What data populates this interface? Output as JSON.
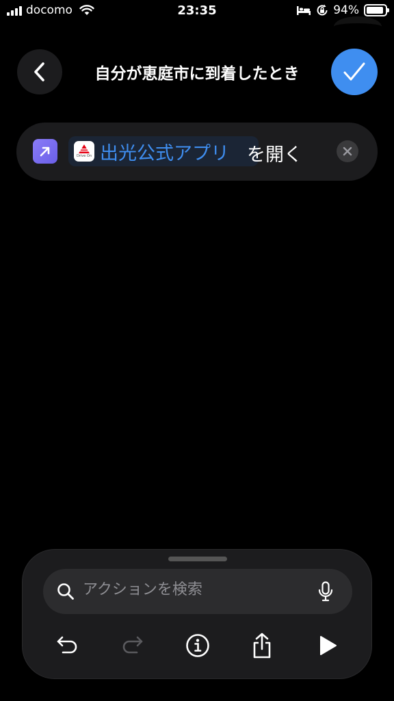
{
  "status_bar": {
    "carrier": "docomo",
    "time": "23:35",
    "battery_percent": "94%",
    "battery_level": 0.94
  },
  "header": {
    "title": "自分が恵庭市に到着したとき"
  },
  "action": {
    "app_name": "出光公式アプリ",
    "verb": "を開く",
    "app_logo_text": "Drive On"
  },
  "bottom_panel": {
    "search_placeholder": "アクションを検索"
  },
  "colors": {
    "accent": "#3f8ef0",
    "background": "#000000",
    "card": "#1c1c1e"
  }
}
